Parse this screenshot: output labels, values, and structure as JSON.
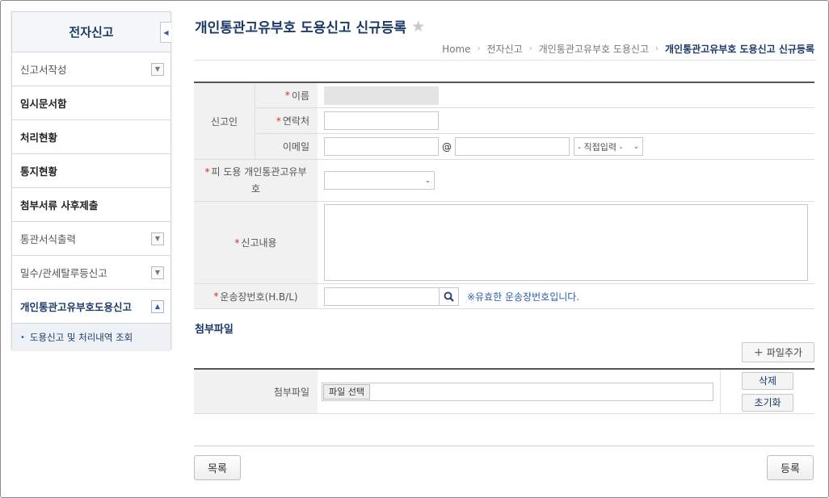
{
  "sidebar": {
    "title": "전자신고",
    "items": [
      {
        "label": "신고서작성"
      },
      {
        "label": "임시문서함"
      },
      {
        "label": "처리현황"
      },
      {
        "label": "통지현황"
      },
      {
        "label": "첨부서류 사후제출"
      },
      {
        "label": "통관서식출력"
      },
      {
        "label": "밀수/관세탈루등신고"
      },
      {
        "label": "개인통관고유부호도용신고"
      }
    ],
    "sub_item": "도용신고 및 처리내역 조회"
  },
  "header": {
    "title": "개인통관고유부호 도용신고 신규등록",
    "breadcrumb": [
      "Home",
      "전자신고",
      "개인통관고유부호 도용신고",
      "개인통관고유부호 도용신고 신규등록"
    ]
  },
  "form": {
    "group_label": "신고인",
    "name_label": "이름",
    "phone_label": "연락처",
    "email_label": "이메일",
    "email_at": "@",
    "email_domain_select": "- 직접입력 -",
    "stolen_code_label": "피 도용 개인통관고유부호",
    "content_label": "신고내용",
    "waybill_label": "운송장번호(H.B/L)",
    "waybill_hint": "※유효한 운송장번호입니다."
  },
  "attachments": {
    "section_title": "첨부파일",
    "add_button": "파일추가",
    "row_label": "첨부파일",
    "file_button": "파일 선택",
    "delete_button": "삭제",
    "reset_button": "초기화"
  },
  "footer": {
    "list_button": "목록",
    "register_button": "등록"
  }
}
